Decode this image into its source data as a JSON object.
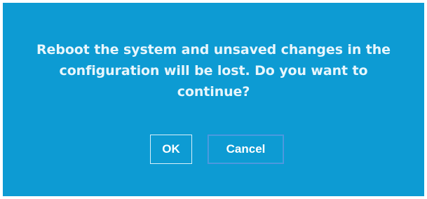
{
  "dialog": {
    "message_lines": [
      "Reboot the system and unsaved changes in the",
      "configuration will be lost. Do you want to",
      "continue?"
    ],
    "ok_label": "OK",
    "cancel_label": "Cancel"
  },
  "colors": {
    "dialog_background": "#0d9bd3",
    "text": "#e8f6fc",
    "ok_border": "#d9f0fa",
    "cancel_border": "#5b8fe0"
  }
}
